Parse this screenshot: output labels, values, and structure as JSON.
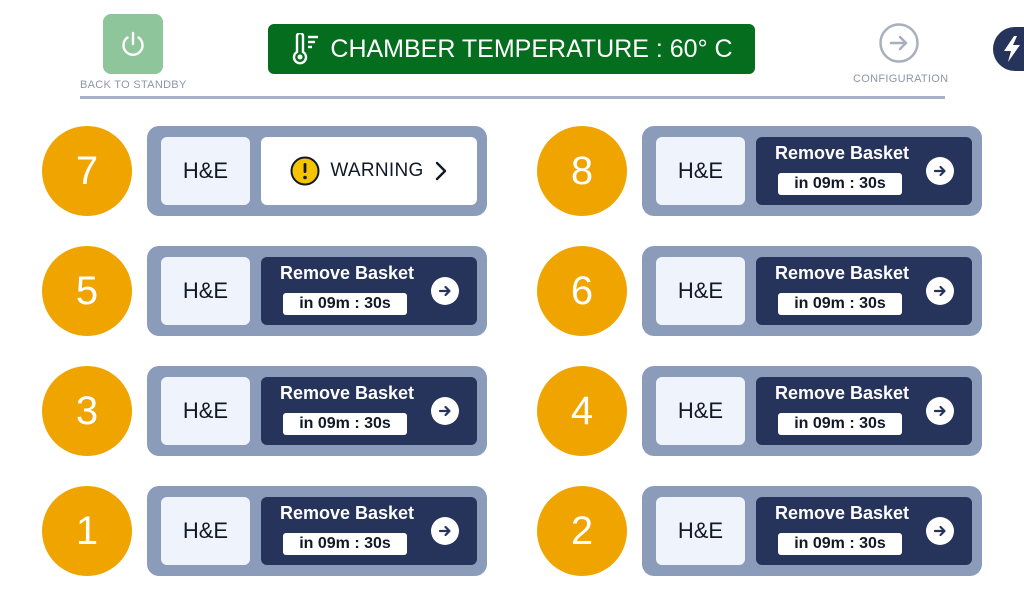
{
  "header": {
    "standby_label": "BACK TO STANDBY",
    "temperature_text": "CHAMBER TEMPERATURE : 60° C",
    "config_label": "CONFIGURATION"
  },
  "colors": {
    "accent_orange": "#efa400",
    "navy": "#26335a",
    "panel": "#8b9bba",
    "temp_green": "#046e1e",
    "standby_green": "#8fc59a",
    "warning_yellow": "#f5c400"
  },
  "stations": [
    {
      "number": "7",
      "stain": "H&E",
      "status": "warning",
      "warning_label": "WARNING"
    },
    {
      "number": "8",
      "stain": "H&E",
      "status": "remove",
      "action_title": "Remove Basket",
      "timer": "in 09m : 30s"
    },
    {
      "number": "5",
      "stain": "H&E",
      "status": "remove",
      "action_title": "Remove Basket",
      "timer": "in 09m : 30s"
    },
    {
      "number": "6",
      "stain": "H&E",
      "status": "remove",
      "action_title": "Remove Basket",
      "timer": "in 09m : 30s"
    },
    {
      "number": "3",
      "stain": "H&E",
      "status": "remove",
      "action_title": "Remove Basket",
      "timer": "in 09m : 30s"
    },
    {
      "number": "4",
      "stain": "H&E",
      "status": "remove",
      "action_title": "Remove Basket",
      "timer": "in 09m : 30s"
    },
    {
      "number": "1",
      "stain": "H&E",
      "status": "remove",
      "action_title": "Remove Basket",
      "timer": "in 09m : 30s"
    },
    {
      "number": "2",
      "stain": "H&E",
      "status": "remove",
      "action_title": "Remove Basket",
      "timer": "in 09m : 30s"
    }
  ],
  "icons": {
    "standby": "power-icon",
    "temperature": "thermometer-icon",
    "configuration": "arrow-right-circle-icon",
    "power_tab": "lightning-icon",
    "warning": "exclamation-circle-icon",
    "warning_chevron": "chevron-right-icon",
    "remove_arrow": "arrow-right-icon"
  }
}
